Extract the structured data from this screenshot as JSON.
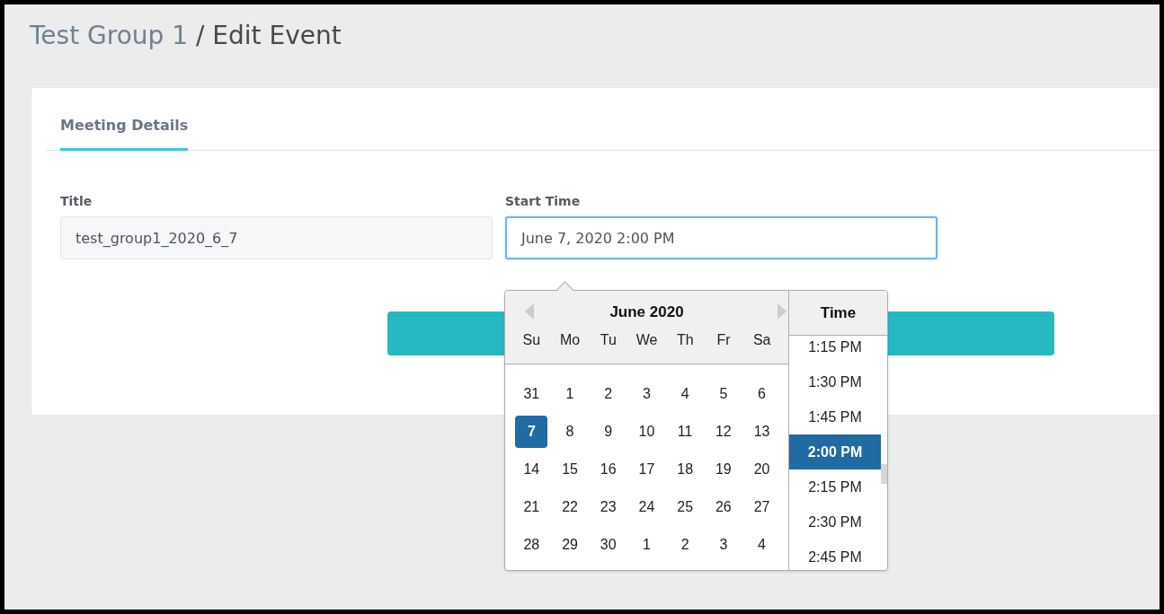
{
  "breadcrumb": {
    "parent": "Test Group 1",
    "current": "/ Edit Event"
  },
  "tabs": [
    {
      "label": "Meeting Details",
      "selected": true
    }
  ],
  "fields": [
    {
      "label": "Title",
      "value": "test_group1_2020_6_7",
      "focused": false
    },
    {
      "label": "Start Time",
      "value": "June 7, 2020 2:00 PM",
      "focused": true
    }
  ],
  "datepicker": {
    "month_label": "June 2020",
    "weekdays": [
      "Su",
      "Mo",
      "Tu",
      "We",
      "Th",
      "Fr",
      "Sa"
    ],
    "weeks": [
      [
        {
          "day": "31",
          "selected": false
        },
        {
          "day": "1",
          "selected": false
        },
        {
          "day": "2",
          "selected": false
        },
        {
          "day": "3",
          "selected": false
        },
        {
          "day": "4",
          "selected": false
        },
        {
          "day": "5",
          "selected": false
        },
        {
          "day": "6",
          "selected": false
        }
      ],
      [
        {
          "day": "7",
          "selected": true
        },
        {
          "day": "8",
          "selected": false
        },
        {
          "day": "9",
          "selected": false
        },
        {
          "day": "10",
          "selected": false
        },
        {
          "day": "11",
          "selected": false
        },
        {
          "day": "12",
          "selected": false
        },
        {
          "day": "13",
          "selected": false
        }
      ],
      [
        {
          "day": "14",
          "selected": false
        },
        {
          "day": "15",
          "selected": false
        },
        {
          "day": "16",
          "selected": false
        },
        {
          "day": "17",
          "selected": false
        },
        {
          "day": "18",
          "selected": false
        },
        {
          "day": "19",
          "selected": false
        },
        {
          "day": "20",
          "selected": false
        }
      ],
      [
        {
          "day": "21",
          "selected": false
        },
        {
          "day": "22",
          "selected": false
        },
        {
          "day": "23",
          "selected": false
        },
        {
          "day": "24",
          "selected": false
        },
        {
          "day": "25",
          "selected": false
        },
        {
          "day": "26",
          "selected": false
        },
        {
          "day": "27",
          "selected": false
        }
      ],
      [
        {
          "day": "28",
          "selected": false
        },
        {
          "day": "29",
          "selected": false
        },
        {
          "day": "30",
          "selected": false
        },
        {
          "day": "1",
          "selected": false
        },
        {
          "day": "2",
          "selected": false
        },
        {
          "day": "3",
          "selected": false
        },
        {
          "day": "4",
          "selected": false
        }
      ]
    ],
    "time_header": "Time",
    "times": [
      {
        "label": "1:15 PM",
        "selected": false
      },
      {
        "label": "1:30 PM",
        "selected": false
      },
      {
        "label": "1:45 PM",
        "selected": false
      },
      {
        "label": "2:00 PM",
        "selected": true
      },
      {
        "label": "2:15 PM",
        "selected": false
      },
      {
        "label": "2:30 PM",
        "selected": false
      },
      {
        "label": "2:45 PM",
        "selected": false
      }
    ]
  }
}
